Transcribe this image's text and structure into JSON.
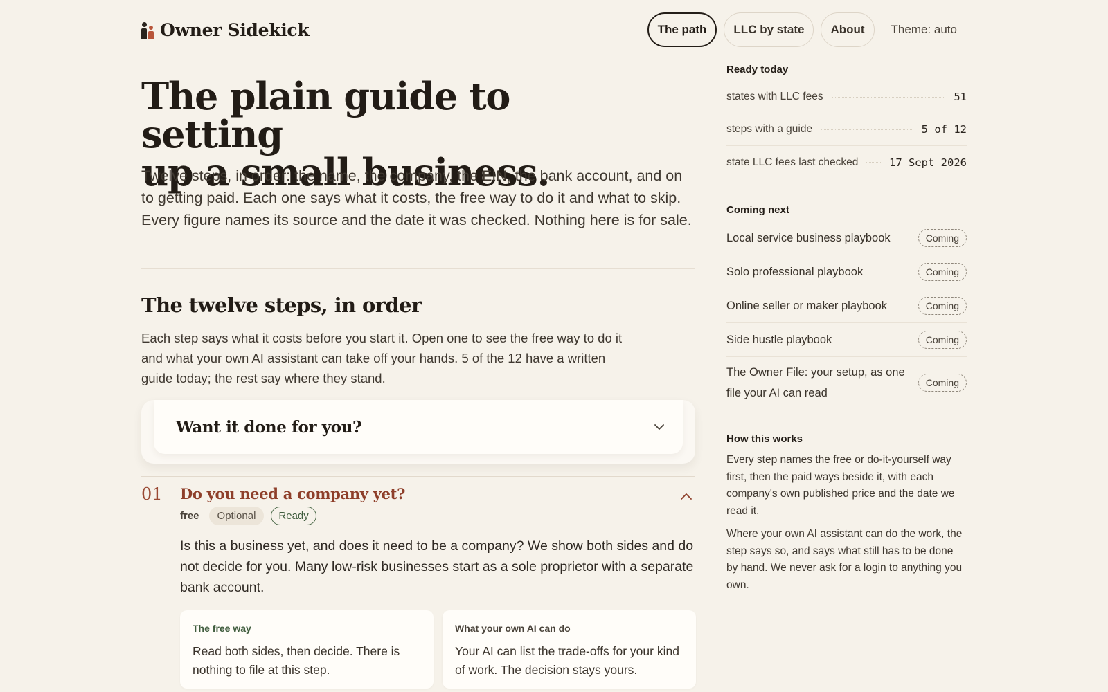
{
  "brand": {
    "name": "Owner Sidekick",
    "colors": {
      "figure_dark": "#2a241e",
      "figure_accent": "#b8553a"
    }
  },
  "nav": {
    "items": [
      {
        "label": "The path",
        "active": true
      },
      {
        "label": "LLC by state",
        "active": false
      },
      {
        "label": "About",
        "active": false
      }
    ],
    "theme_label": "Theme: auto"
  },
  "hero": {
    "title_line1": "The plain guide to setting",
    "title_line2": "up a small business.",
    "lede": "Twelve steps, in order: the name, the company, the EIN, the bank account, and on to getting paid. Each one says what it costs, the free way to do it and what to skip. Every figure names its source and the date it was checked. Nothing here is for sale."
  },
  "steps_section": {
    "title": "The twelve steps, in order",
    "intro": "Each step says what it costs before you start it. Open one to see the free way to do it and what your own AI assistant can take off your hands. 5 of the 12 have a written guide today; the rest say where they stand."
  },
  "done_for_you": {
    "title": "Want it done for you?",
    "expanded": false
  },
  "step": {
    "number": "01",
    "title": "Do you need a company yet?",
    "expanded": true,
    "cost": "free",
    "tags": {
      "optional": "Optional",
      "ready": "Ready"
    },
    "body": "Is this a business yet, and does it need to be a company? We show both sides and do not decide for you. Many low-risk businesses start as a sole proprietor with a separate bank account.",
    "free_way": {
      "label": "The free way",
      "text": "Read both sides, then decide. There is nothing to file at this step."
    },
    "ai_can_do": {
      "label": "What your own AI can do",
      "text": "Your AI can list the trade-offs for your kind of work. The decision stays yours."
    }
  },
  "sidebar": {
    "ready_today": {
      "heading": "Ready today",
      "stats": [
        {
          "label": "states with LLC fees",
          "value": "51"
        },
        {
          "label": "steps with a guide",
          "value": "5 of 12"
        },
        {
          "label": "state LLC fees last checked",
          "value": "17 Sept 2026"
        }
      ]
    },
    "coming_next": {
      "heading": "Coming next",
      "items": [
        {
          "label": "Local service business playbook",
          "tag": "Coming"
        },
        {
          "label": "Solo professional playbook",
          "tag": "Coming"
        },
        {
          "label": "Online seller or maker playbook",
          "tag": "Coming"
        },
        {
          "label": "Side hustle playbook",
          "tag": "Coming"
        },
        {
          "label": "The Owner File: your setup, as one file your AI can read",
          "tag": "Coming"
        }
      ]
    },
    "how_it_works": {
      "heading": "How this works",
      "paragraph1": "Every step names the free or do-it-yourself way first, then the paid ways beside it, with each company's own published price and the date we read it.",
      "paragraph2": "Where your own AI assistant can do the work, the step says so, and says what still has to be done by hand. We never ask for a login to anything you own."
    }
  },
  "colors": {
    "background": "#f6f2ea",
    "accent_rust": "#8e3f2a",
    "ready_green": "#3f5c3d"
  }
}
